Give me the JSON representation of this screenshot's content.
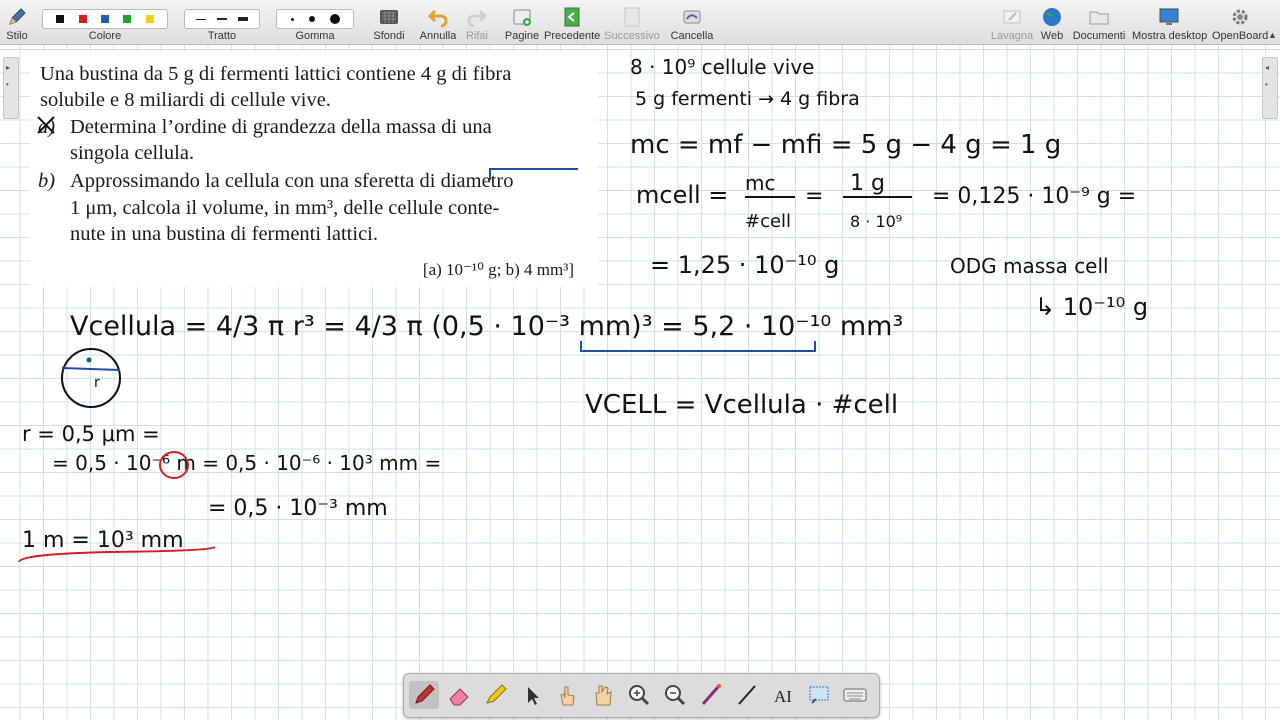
{
  "toolbar": {
    "stylus_label": "Stilo",
    "color_label": "Colore",
    "stroke_label": "Tratto",
    "eraser_label": "Gomma",
    "backgrounds_label": "Sfondi",
    "undo_label": "Annulla",
    "redo_label": "Rifai",
    "pages_label": "Pagine",
    "previous_label": "Precedente",
    "next_label": "Successivo",
    "erase_label": "Cancella",
    "board_label": "Lavagna",
    "web_label": "Web",
    "documents_label": "Documenti",
    "desktop_label": "Mostra desktop",
    "openboard_label": "OpenBoard",
    "colors": [
      "#111111",
      "#d42020",
      "#1f5fb8",
      "#26a026",
      "#f2d21b"
    ]
  },
  "problem": {
    "line1": "Una bustina da 5 g di fermenti lattici contiene 4 g di fibra",
    "line2": "solubile e 8 miliardi di cellule vive.",
    "a_marker": "a)",
    "a_line1": "Determina l’ordine di grandezza della massa di una",
    "a_line2": "singola cellula.",
    "b_marker": "b)",
    "b_line1": "Approssimando la cellula con una sferetta di diametro",
    "b_line2": "1 μm, calcola il volume, in mm³, delle cellule conte-",
    "b_line3": "nute in una bustina di fermenti lattici.",
    "answers": "[a) 10⁻¹⁰ g; b) 4 mm³]"
  },
  "notes": {
    "n1": "8 · 10⁹ cellule vive",
    "n2": "5 g fermenti → 4 g fibra",
    "n3": "mc = mf − mfi = 5 g − 4 g = 1 g",
    "n4_lhs": "mcell =",
    "n4_frac1_num": "mc",
    "n4_frac1_den": "#cell",
    "n4_frac2_num": "1 g",
    "n4_frac2_den": "8 · 10⁹",
    "n4_result": "= 0,125 · 10⁻⁹ g =",
    "n5": "= 1,25 · 10⁻¹⁰ g",
    "odg": "ODG massa cell",
    "odg_result": "↳ 10⁻¹⁰ g",
    "volume_cell": "Vcellula = 4/3 π r³ = 4/3 π (0,5 · 10⁻³ mm)³ = 5,2 · 10⁻¹⁰ mm³",
    "sphere_label": "r",
    "r_line1": "r = 0,5 μm =",
    "r_line2": "= 0,5 · 10⁻⁶ m = 0,5 · 10⁻⁶ · 10³ mm =",
    "r_line3": "= 0,5 · 10⁻³ mm",
    "conv": "1 m = 10³ mm",
    "vtot": "VCELL = Vcellula · #cell"
  },
  "bottom_tools": [
    "pen-tool",
    "eraser-tool",
    "highlighter-tool",
    "select-tool",
    "interact-tool",
    "hand-tool",
    "zoom-in-tool",
    "zoom-out-tool",
    "laser-pointer-tool",
    "line-tool",
    "text-tool",
    "capture-tool",
    "virtual-keyboard-tool"
  ]
}
